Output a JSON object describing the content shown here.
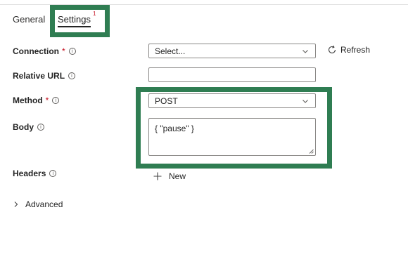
{
  "tabs": {
    "general": "General",
    "settings": "Settings",
    "settings_badge": "1"
  },
  "form": {
    "connection": {
      "label": "Connection",
      "required": "*",
      "value": "Select..."
    },
    "refresh_label": "Refresh",
    "relative_url": {
      "label": "Relative URL",
      "value": ""
    },
    "method": {
      "label": "Method",
      "required": "*",
      "value": "POST"
    },
    "body": {
      "label": "Body",
      "value": "{ \"pause\" }"
    },
    "headers": {
      "label": "Headers",
      "new_label": "New"
    },
    "advanced_label": "Advanced"
  },
  "colors": {
    "highlight": "#2f7d52",
    "required": "#c50f1f"
  },
  "icons": {
    "info": "info-icon",
    "refresh": "refresh-icon",
    "chevron": "chevron-down-icon",
    "add": "plus-icon",
    "expand": "chevron-right-icon"
  }
}
